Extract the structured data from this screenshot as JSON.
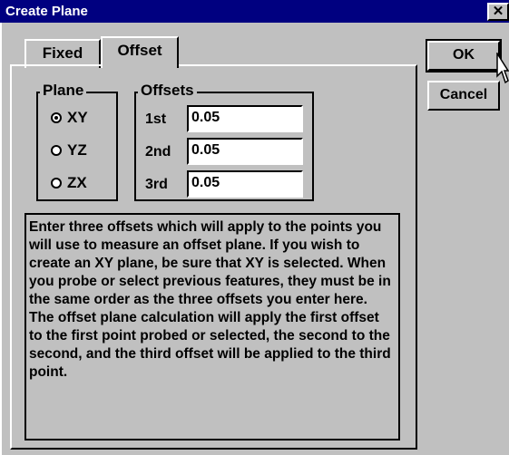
{
  "window": {
    "title": "Create Plane",
    "close_glyph": "✕"
  },
  "tabs": [
    {
      "label": "Fixed"
    },
    {
      "label": "Offset"
    }
  ],
  "plane_group": {
    "legend": "Plane",
    "options": [
      {
        "label": "XY",
        "selected": true
      },
      {
        "label": "YZ",
        "selected": false
      },
      {
        "label": "ZX",
        "selected": false
      }
    ]
  },
  "offsets_group": {
    "legend": "Offsets",
    "rows": [
      {
        "label": "1st",
        "value": "0.05"
      },
      {
        "label": "2nd",
        "value": "0.05"
      },
      {
        "label": "3rd",
        "value": "0.05"
      }
    ]
  },
  "description": "Enter three offsets which will apply to the points you will use to measure an offset plane.  If you wish to create an XY plane, be sure that XY is selected.  When you probe or select previous features, they must be in the same order as the three offsets you enter here.  The offset plane calculation will apply the first offset to the first point probed or selected, the second to the second, and the third offset will be applied to the third point.",
  "buttons": {
    "ok": "OK",
    "cancel": "Cancel"
  },
  "icons": {
    "cursor": "mouse-pointer-icon"
  }
}
